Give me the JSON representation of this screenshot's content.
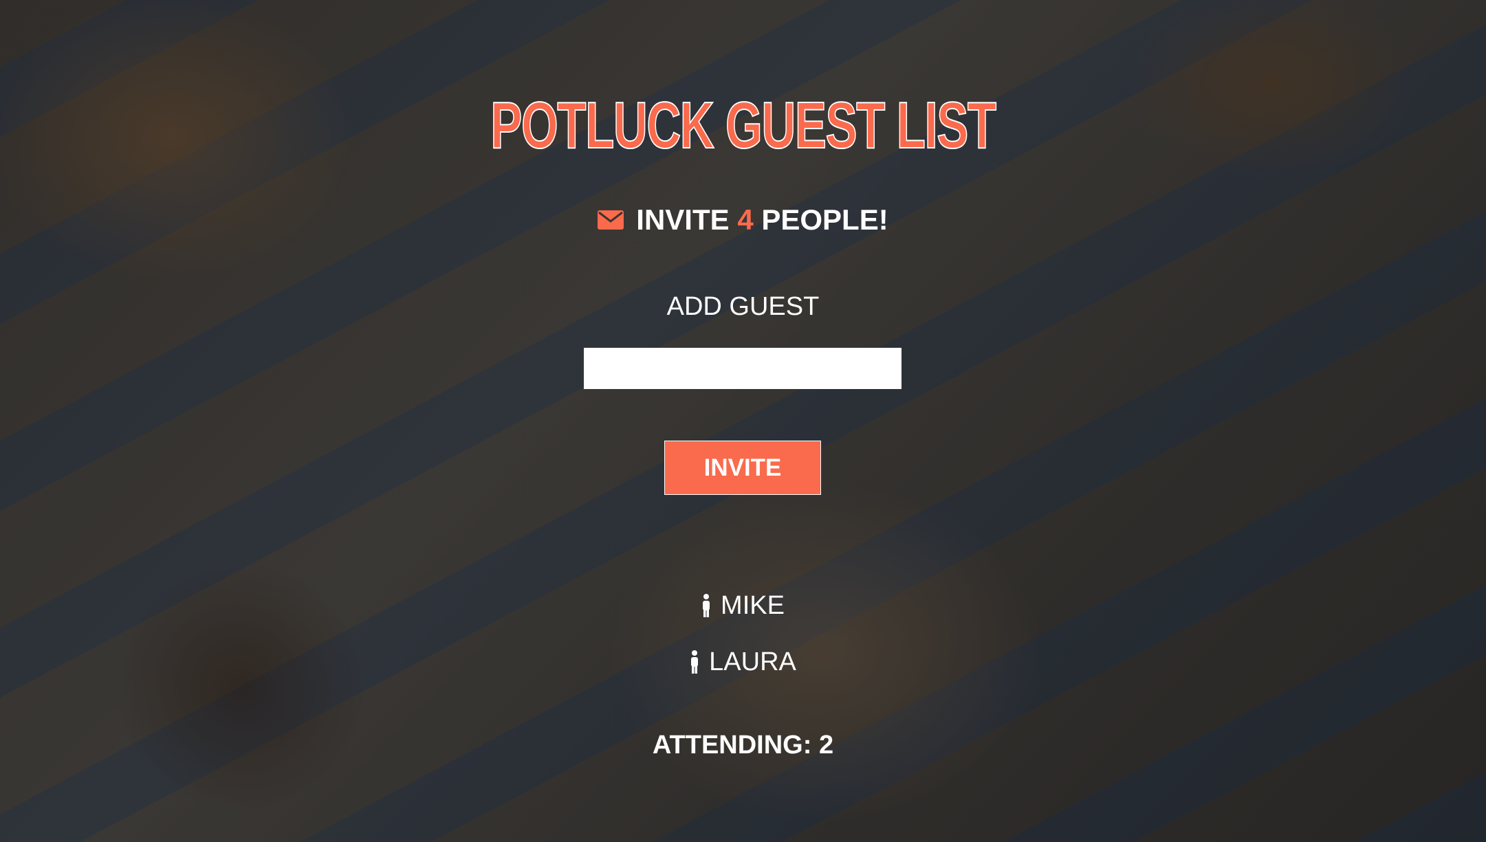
{
  "page": {
    "title": "POTLUCK GUEST LIST"
  },
  "invite": {
    "prefix": "INVITE",
    "count": "4",
    "suffix": "PEOPLE!",
    "icon": "envelope-icon"
  },
  "form": {
    "label": "ADD GUEST",
    "input_value": "",
    "button_label": "INVITE"
  },
  "guests": [
    {
      "name": "MIKE",
      "icon": "person-icon"
    },
    {
      "name": "LAURA",
      "icon": "person-icon"
    }
  ],
  "attending": {
    "text": "ATTENDING: 2"
  },
  "colors": {
    "accent": "#fa6a4d",
    "text": "#ffffff"
  }
}
